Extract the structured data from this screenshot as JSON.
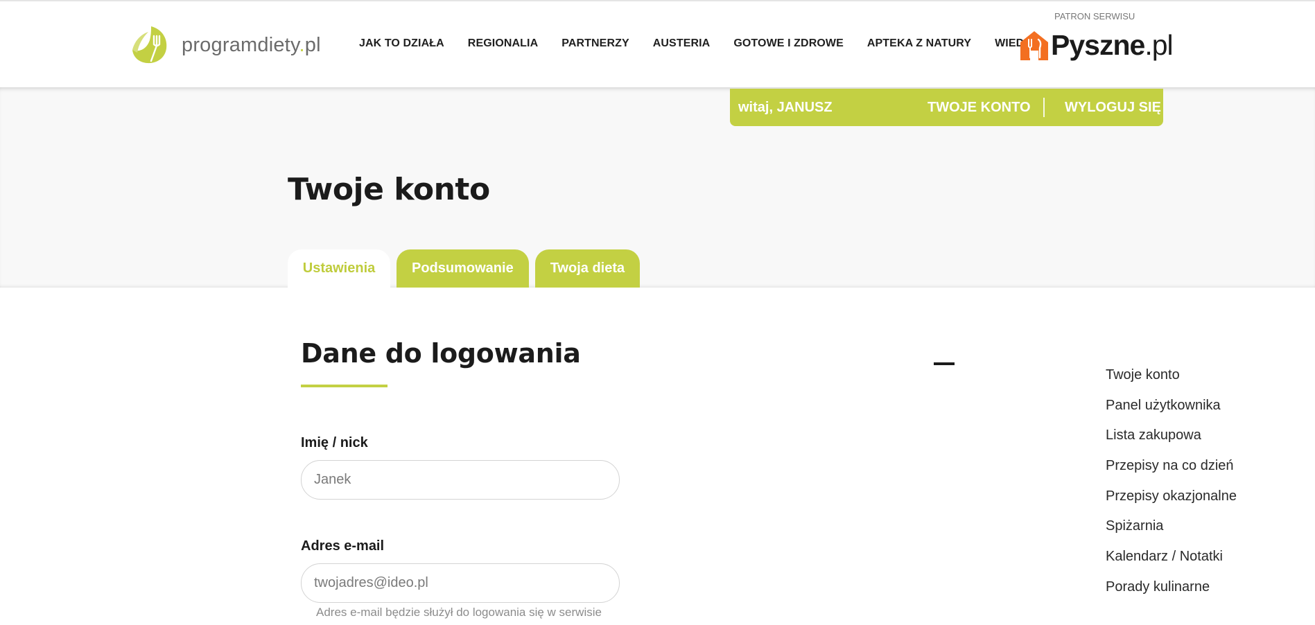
{
  "header": {
    "logo_text": "programdiety",
    "logo_suffix_dot": ".",
    "logo_suffix": "pl",
    "nav": [
      {
        "label": "JAK TO DZIAŁA"
      },
      {
        "label": "REGIONALIA"
      },
      {
        "label": "PARTNERZY"
      },
      {
        "label": "AUSTERIA"
      },
      {
        "label": "GOTOWE I ZDROWE"
      },
      {
        "label": "APTEKA Z NATURY"
      },
      {
        "label": "WIEDZA"
      }
    ],
    "patron_label": "PATRON SERWISU",
    "partner_name": "Pyszne",
    "partner_suffix": ".pl"
  },
  "userbar": {
    "greeting": "witaj, JANUSZ",
    "account_link": "TWOJE KONTO",
    "logout_link": "WYLOGUJ SIĘ"
  },
  "page": {
    "title": "Twoje konto",
    "tabs": [
      {
        "label": "Ustawienia",
        "active": true
      },
      {
        "label": "Podsumowanie",
        "active": false
      },
      {
        "label": "Twoja dieta",
        "active": false
      }
    ]
  },
  "form": {
    "section_title": "Dane do logowania",
    "name_label": "Imię / nick",
    "name_placeholder": "Janek",
    "email_label": "Adres e-mail",
    "email_placeholder": "twojadres@ideo.pl",
    "email_hint": "Adres e-mail będzie służył do logowania się w serwisie"
  },
  "sidebar": {
    "items": [
      {
        "label": "Twoje konto"
      },
      {
        "label": "Panel użytkownika"
      },
      {
        "label": "Lista zakupowa"
      },
      {
        "label": "Przepisy na co dzień"
      },
      {
        "label": "Przepisy okazjonalne"
      },
      {
        "label": "Spiżarnia"
      },
      {
        "label": "Kalendarz / Notatki"
      },
      {
        "label": "Porady kulinarne"
      }
    ]
  },
  "colors": {
    "accent": "#c3d043",
    "partner_orange": "#f36f21",
    "text_dark": "#1b1b1b",
    "hero_bg": "#f8f8f8"
  },
  "icons": {
    "logo": "leaf-fork-icon",
    "partner": "house-fork-icon",
    "collapse": "minus-icon"
  }
}
